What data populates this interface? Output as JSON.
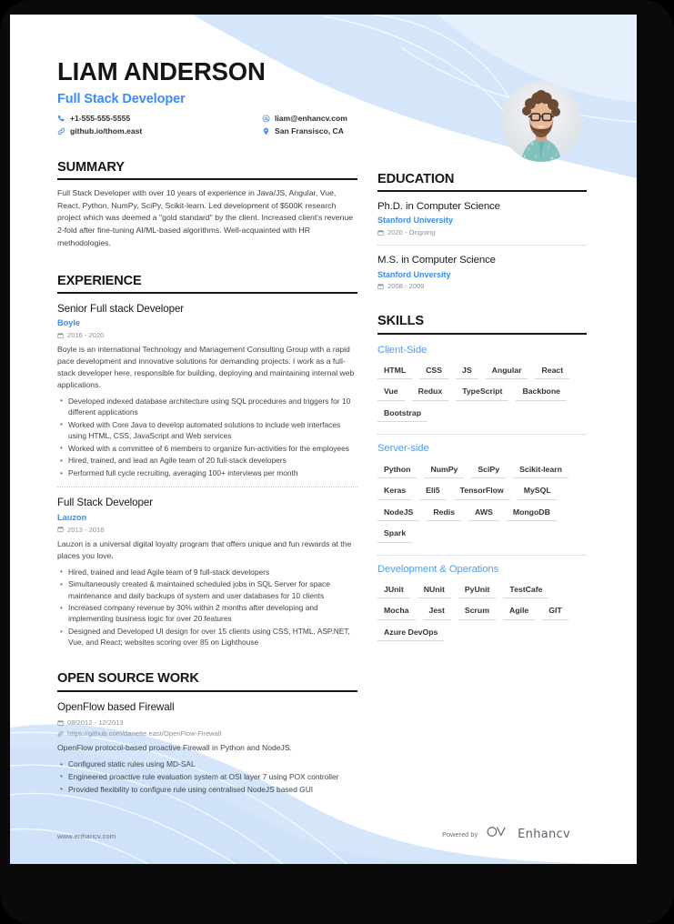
{
  "header": {
    "name": "LIAM ANDERSON",
    "role": "Full Stack Developer",
    "contacts": [
      {
        "icon": "phone-icon",
        "text": "+1-555-555-5555"
      },
      {
        "icon": "link-icon",
        "text": "github.io/thom.east"
      },
      {
        "icon": "email-icon",
        "text": "liam@enhancv.com"
      },
      {
        "icon": "location-icon",
        "text": "San Fransisco, CA"
      }
    ]
  },
  "summary": {
    "title": "SUMMARY",
    "text": "Full Stack Developer with over 10 years of experience in Java/JS, Angular, Vue, React, Python, NumPy, SciPy, Scikit-learn. Led development of $500K research project which was deemed a \"gold standard\" by the client. Increased client's revenue 2-fold after fine-tuning AI/ML-based algorithms. Well-acquainted with HR methodologies."
  },
  "experience": {
    "title": "EXPERIENCE",
    "entries": [
      {
        "role": "Senior Full stack Developer",
        "company": "Boyle",
        "dates": "2016 - 2020",
        "description": "Boyle is an international Technology and Management Consulting Group with a rapid pace development and innovative solutions for demanding projects. I work as a full-stack developer here, responsible for building, deploying and maintaining internal web applications.",
        "bullets": [
          "Developed indexed database architecture using SQL procedures and triggers for 10 different applications",
          "Worked with Core Java to develop automated solutions to include web interfaces using HTML, CSS, JavaScript and Web services",
          "Worked with a committee of 6 members to organize fun-activities for the employees",
          "Hired, trained, and lead an Agile team of 20 full-stack developers",
          "Performed full cycle recruiting, averaging 100+ interviews per month"
        ]
      },
      {
        "role": "Full Stack Developer",
        "company": "Lauzon",
        "dates": "2013 - 2016",
        "description": "Lauzon is a universal digital loyalty program that offers unique and fun rewards at the places you love.",
        "bullets": [
          "Hired, trained and lead Agile team of 9 full-stack developers",
          "Simultaneously created & maintained scheduled jobs in SQL Server for space maintenance and daily backups of system and user databases for 10 clients",
          "Increased company revenue by 30% within 2 months after developing and implementing business logic for over 20 features",
          "Designed and Developed UI design for over 15 clients using CSS, HTML, ASP.NET, Vue, and React; websites scoring over 85 on Lighthouse"
        ]
      }
    ]
  },
  "open_source": {
    "title": "OPEN SOURCE WORK",
    "entries": [
      {
        "project": "OpenFlow based Firewall",
        "dates": "08/2012 - 12/2013",
        "url": "https://github.com/danette.east/OpenFlow-Firewall",
        "description": "OpenFlow protocol-based proactive Firewall in Python and NodeJS.",
        "bullets": [
          "Configured static rules using MD-SAL",
          "Engineered proactive rule evaluation system at OSI layer 7 using POX controller",
          "Provided flexibility to configure rule using centralised NodeJS based GUI"
        ]
      }
    ]
  },
  "education": {
    "title": "EDUCATION",
    "entries": [
      {
        "degree": "Ph.D. in Computer Science",
        "school": "Stanford University",
        "dates": "2020 - Ongoing"
      },
      {
        "degree": "M.S. in Computer Science",
        "school": "Stanford Unversity",
        "dates": "2008 - 2009"
      }
    ]
  },
  "skills": {
    "title": "SKILLS",
    "groups": [
      {
        "name": "Client-Side",
        "items": [
          "HTML",
          "CSS",
          "JS",
          "Angular",
          "React",
          "Vue",
          "Redux",
          "TypeScript",
          "Backbone",
          "Bootstrap"
        ]
      },
      {
        "name": "Server-side",
        "items": [
          "Python",
          "NumPy",
          "SciPy",
          "Scikit-learn",
          "Keras",
          "Eli5",
          "TensorFlow",
          "MySQL",
          "NodeJS",
          "Redis",
          "AWS",
          "MongoDB",
          "Spark"
        ]
      },
      {
        "name": "Development & Operations",
        "items": [
          "JUnit",
          "NUnit",
          "PyUnit",
          "TestCafe",
          "Mocha",
          "Jest",
          "Scrum",
          "Agile",
          "GIT",
          "Azure DevOps"
        ]
      }
    ]
  },
  "footer": {
    "site_url": "www.enhancv.com",
    "powered_by": "Powered by",
    "brand": "Enhancv"
  },
  "colors": {
    "accent_blue": "#3a8bfd",
    "skill_heading_blue": "#4e9bfd",
    "wave_blue": "#d6e6fa",
    "heading_dark": "#15161a",
    "body_gray": "#3f444b",
    "meta_gray": "#8b9099"
  }
}
